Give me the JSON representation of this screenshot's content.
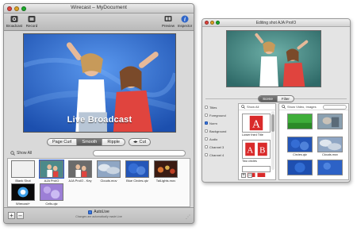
{
  "main_window": {
    "title": "Wirecast – MyDocument",
    "toolbar": {
      "broadcast_label": "Broadcast",
      "record_label": "Record",
      "preview_label": "Preview",
      "inspector_label": "Inspector"
    },
    "live_text": "Live Broadcast",
    "transitions": {
      "options": [
        "Page Curl",
        "Smooth",
        "Ripple"
      ],
      "selected": "Smooth",
      "cut_label": "Cut"
    },
    "search": {
      "show_all_label": "Show All",
      "value": ""
    },
    "shots": [
      {
        "label": "Blank Shot"
      },
      {
        "label": "AJA ProIO"
      },
      {
        "label": "AJA ProIO - Key"
      },
      {
        "label": "Clouds.mov"
      },
      {
        "label": "Blue Circles.qtz"
      },
      {
        "label": "TalLights.mov"
      },
      {
        "label": "Wirecast+"
      },
      {
        "label": "Cells.qtz"
      }
    ],
    "autolive": {
      "label": "AutoLive",
      "sublabel": "Changes are automatically made Live",
      "checked": true
    },
    "add_label": "+",
    "remove_label": "–"
  },
  "inspector": {
    "title": "Editing shot AJA ProIO",
    "tabs": [
      "Scene",
      "Filter"
    ],
    "layers": [
      {
        "label": "Titles",
        "checked": false
      },
      {
        "label": "Foreground",
        "checked": false
      },
      {
        "label": "Norm",
        "checked": true
      },
      {
        "label": "Background",
        "checked": false
      },
      {
        "label": "Audio",
        "checked": false
      },
      {
        "label": "Channel 3",
        "checked": false
      },
      {
        "label": "Channel 4",
        "checked": false
      }
    ],
    "source_panel": {
      "show_all_label": "Show All",
      "items": [
        {
          "label": "Lower third Title"
        },
        {
          "label": "Two circles"
        }
      ]
    },
    "media_panel": {
      "header_label": "Show Video, Images",
      "search_value": "",
      "items": [
        {
          "label": ""
        },
        {
          "label": ""
        },
        {
          "label": "Circles.qtz"
        },
        {
          "label": "Clouds.mov"
        },
        {
          "label": ""
        },
        {
          "label": ""
        }
      ]
    },
    "add_label": "+",
    "remove_label": "–"
  },
  "colors": {
    "live_background": "#2f6fd1",
    "accent_blue": "#3a7ae0",
    "selected_segment": "#5a5a5a"
  },
  "icons": [
    "broadcast-icon",
    "record-icon",
    "preview-icon",
    "inspector-icon",
    "search-icon"
  ]
}
